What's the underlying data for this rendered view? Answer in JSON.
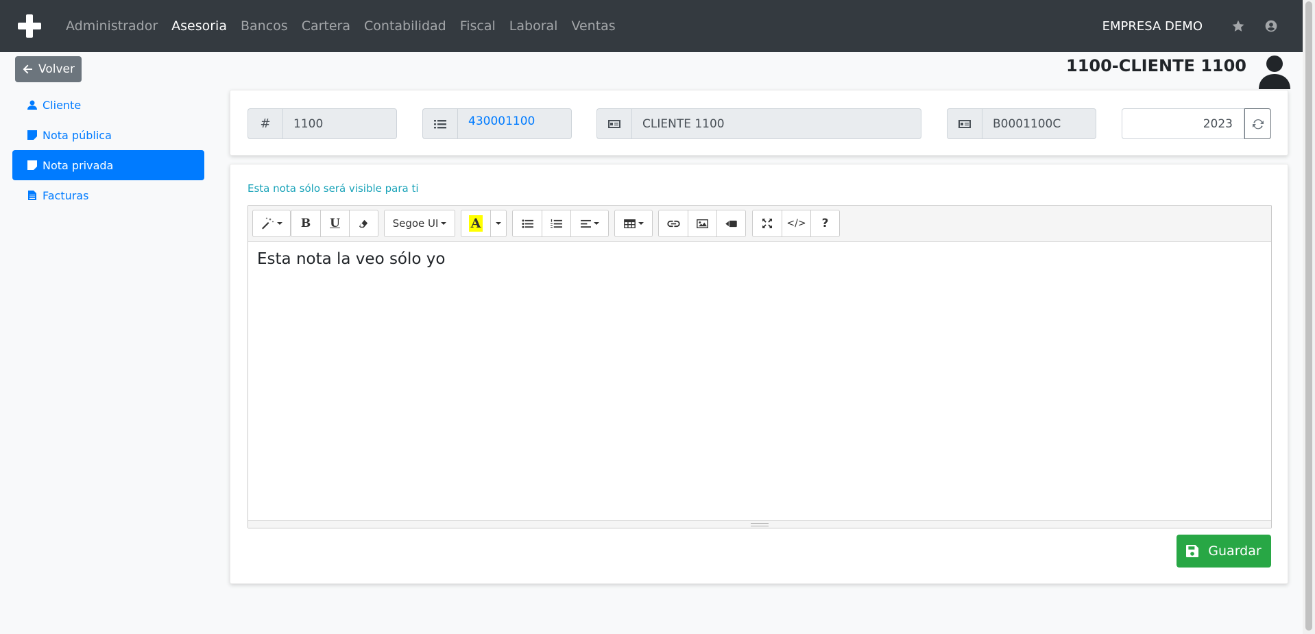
{
  "navbar": {
    "brand_icon": "plus-icon",
    "links": [
      "Administrador",
      "Asesoria",
      "Bancos",
      "Cartera",
      "Contabilidad",
      "Fiscal",
      "Laboral",
      "Ventas"
    ],
    "active_link": "Asesoria",
    "company": "EMPRESA DEMO",
    "right_icons": [
      "star-icon",
      "user-circle-icon"
    ]
  },
  "back_button": {
    "label": "Volver",
    "icon": "arrow-left-icon"
  },
  "header": {
    "title": "1100-CLIENTE 1100",
    "icon": "user-icon"
  },
  "sidebar": {
    "items": [
      {
        "label": "Cliente",
        "icon": "user-icon",
        "active": false
      },
      {
        "label": "Nota pública",
        "icon": "sticky-note-icon",
        "active": false
      },
      {
        "label": "Nota privada",
        "icon": "sticky-note-icon",
        "active": true
      },
      {
        "label": "Facturas",
        "icon": "file-icon",
        "active": false
      }
    ]
  },
  "record": {
    "code_addon": "#",
    "code": "1100",
    "account": "430001100",
    "name": "CLIENTE 1100",
    "tax_id": "B0001100C",
    "year": "2023"
  },
  "note": {
    "hint": "Esta nota sólo será visible para ti",
    "content": "Esta nota la veo sólo yo",
    "font_name": "Segoe UI",
    "highlight_color": "#ffff00"
  },
  "save_button": {
    "label": "Guardar",
    "icon": "save-icon"
  },
  "colors": {
    "navbar": "#343a40",
    "primary": "#007bff",
    "success": "#28a745",
    "secondary": "#6c757d",
    "info": "#17a2b8"
  }
}
